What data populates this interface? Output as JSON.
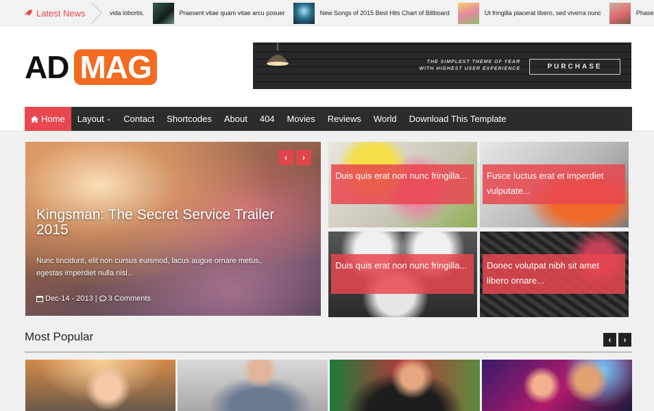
{
  "ticker": {
    "label": "Latest News",
    "items": [
      {
        "text": "vida lobortis.",
        "has_thumb": false
      },
      {
        "text": "Praesent vitae quam vitae arcu posuer",
        "has_thumb": true
      },
      {
        "text": "New Songs of 2015 Best Hits Chart of Billboard",
        "has_thumb": true
      },
      {
        "text": "Ut fringilla placerat libero, sed viverra nunc",
        "has_thumb": true
      },
      {
        "text": "Phasellus eleif",
        "has_thumb": true
      }
    ]
  },
  "logo": {
    "part1": "AD",
    "part2": "MAG"
  },
  "banner": {
    "line1": "THE SIMPLEST THEME OF YEAR",
    "line2": "WITH HIGHEST USER EXPERIENCE",
    "button": "PURCHASE"
  },
  "nav": {
    "items": [
      {
        "label": "Home",
        "active": true
      },
      {
        "label": "Layout",
        "dropdown": true
      },
      {
        "label": "Contact"
      },
      {
        "label": "Shortcodes"
      },
      {
        "label": "About"
      },
      {
        "label": "404"
      },
      {
        "label": "Movies"
      },
      {
        "label": "Reviews"
      },
      {
        "label": "World"
      },
      {
        "label": "Download This Template"
      }
    ]
  },
  "slider": {
    "prev": "‹",
    "next": "›",
    "title": "Kingsman: The Secret Service Trailer 2015",
    "excerpt": "Nunc tincidunt, elit non cursus euismod, lacus augue ornare metus, egestas imperdiet nulla nisl...",
    "date": "Dec-14 - 2013",
    "separator": "|",
    "comments": "3 Comments"
  },
  "grid": [
    {
      "caption": "Duis quis erat non nunc fringilla..."
    },
    {
      "caption": "Fusce luctus erat et imperdiet vulputate..."
    },
    {
      "caption": "Duis quis erat non nunc fringilla..."
    },
    {
      "caption": "Donec volutpat nibh sit amet libero ornare..."
    }
  ],
  "most_popular": {
    "title": "Most Popular",
    "prev": "‹",
    "next": "›"
  },
  "colors": {
    "accent": "#e8474f",
    "logo_orange": "#f26b21",
    "nav_bg": "#2c2c2c"
  }
}
